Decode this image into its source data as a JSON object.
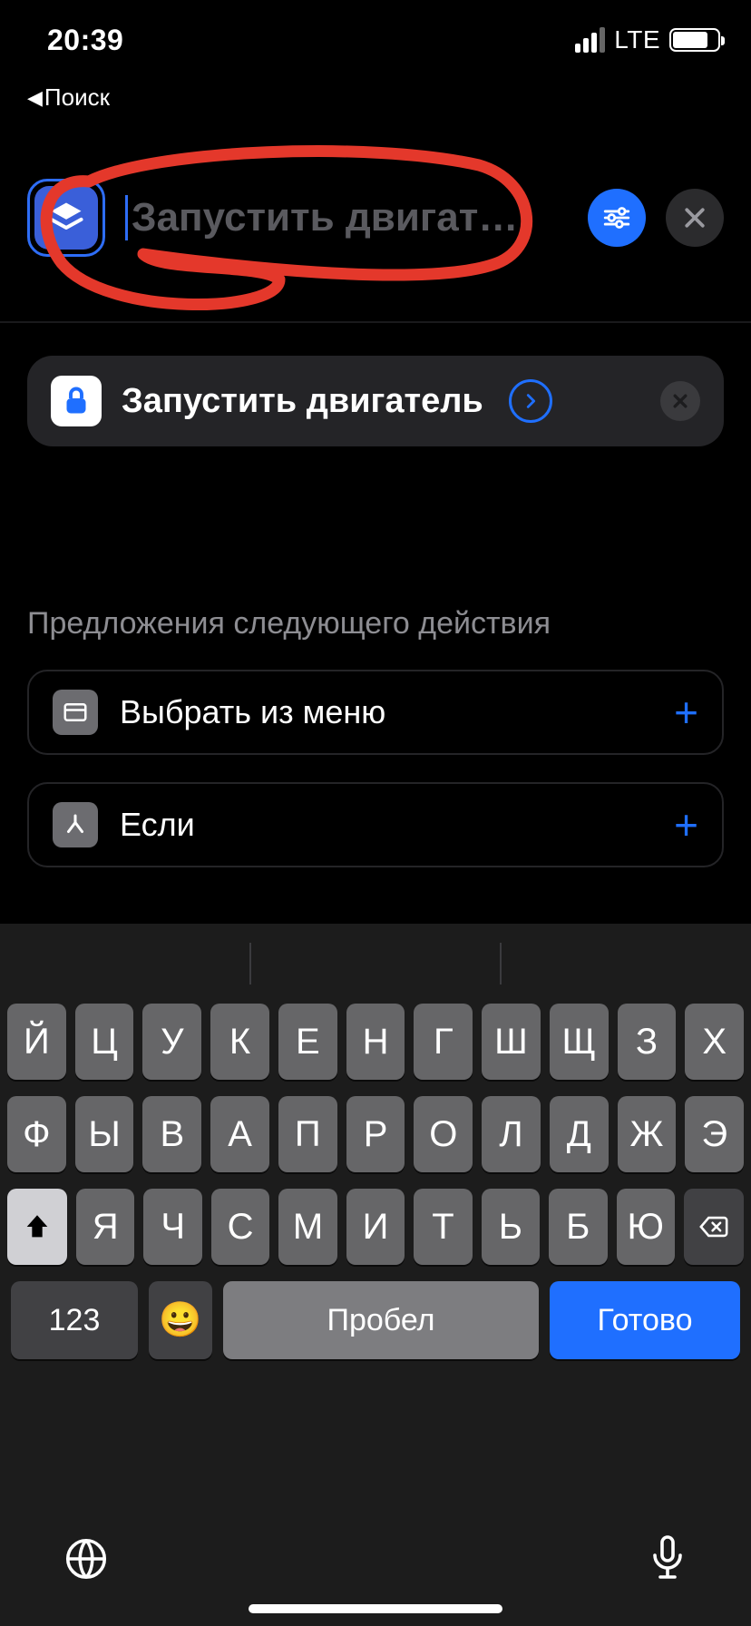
{
  "status": {
    "time": "20:39",
    "net": "LTE"
  },
  "nav": {
    "back_label": "Поиск"
  },
  "header": {
    "placeholder": "Запустить двигат…"
  },
  "action": {
    "label": "Запустить двигатель"
  },
  "section": {
    "title": "Предложения следующего действия"
  },
  "suggestions": [
    {
      "label": "Выбрать из меню"
    },
    {
      "label": "Если"
    }
  ],
  "keyboard": {
    "row1": [
      "Й",
      "Ц",
      "У",
      "К",
      "Е",
      "Н",
      "Г",
      "Ш",
      "Щ",
      "З",
      "Х"
    ],
    "row2": [
      "Ф",
      "Ы",
      "В",
      "А",
      "П",
      "Р",
      "О",
      "Л",
      "Д",
      "Ж",
      "Э"
    ],
    "row3": [
      "Я",
      "Ч",
      "С",
      "М",
      "И",
      "Т",
      "Ь",
      "Б",
      "Ю"
    ],
    "num": "123",
    "space": "Пробел",
    "done": "Готово"
  }
}
